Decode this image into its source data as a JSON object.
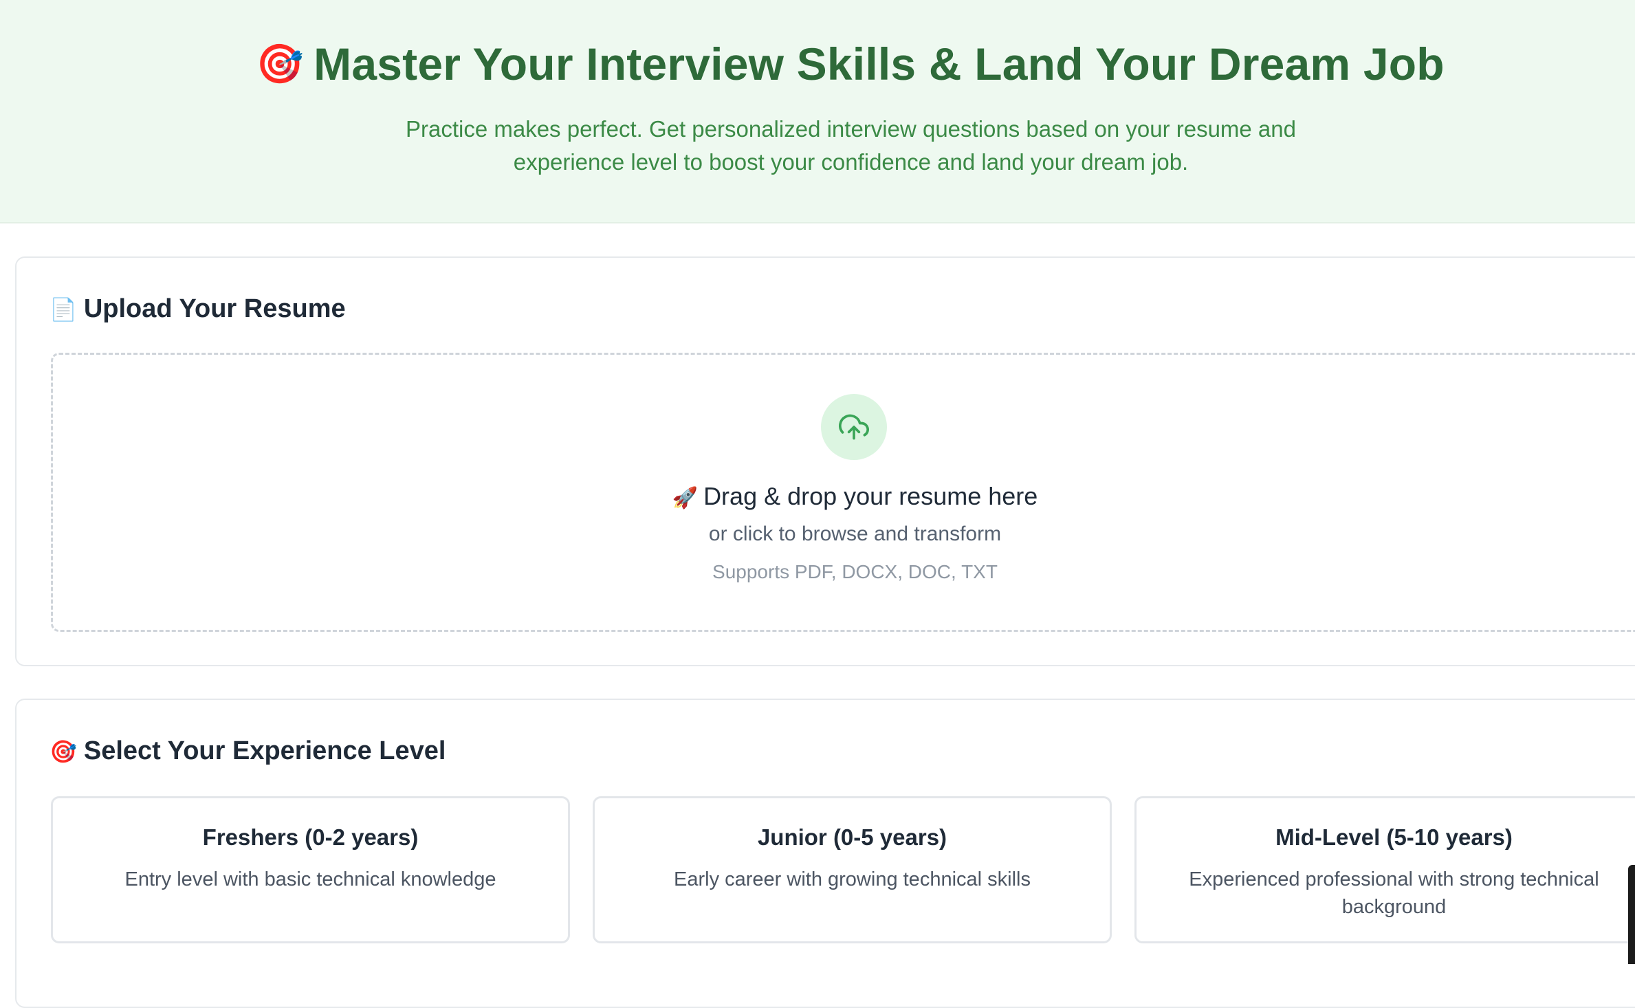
{
  "hero": {
    "emoji": "🎯",
    "title": "Master Your Interview Skills & Land Your Dream Job",
    "subtitle_line1": "Practice makes perfect. Get personalized interview questions based on your resume and",
    "subtitle_line2": "experience level to boost your confidence and land your dream job."
  },
  "upload": {
    "emoji": "📄",
    "title": "Upload Your Resume",
    "icon": "cloud-upload-icon",
    "drop_emoji": "🚀",
    "drop_title": "Drag & drop your resume here",
    "browse_text": "or click to browse and transform",
    "formats_text": "Supports PDF, DOCX, DOC, TXT"
  },
  "experience": {
    "emoji": "🎯",
    "title": "Select Your Experience Level",
    "levels": [
      {
        "title": "Freshers (0-2 years)",
        "desc": "Entry level with basic technical knowledge"
      },
      {
        "title": "Junior (0-5 years)",
        "desc": "Early career with growing technical skills"
      },
      {
        "title": "Mid-Level (5-10 years)",
        "desc": "Experienced professional with strong technical background"
      }
    ]
  },
  "colors": {
    "hero_bg": "#eef9f0",
    "accent_green": "#2e6a39",
    "subtitle_green": "#3b8a46",
    "icon_green": "#3aa557",
    "icon_circle_bg": "#dcf5e1"
  }
}
